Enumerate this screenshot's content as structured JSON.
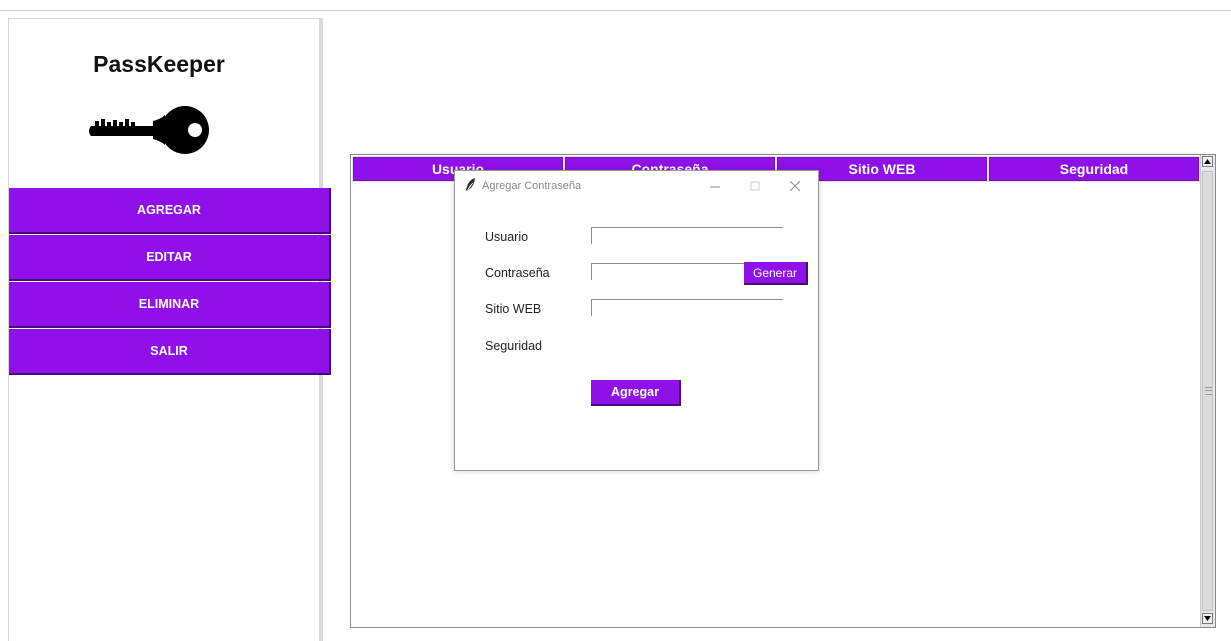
{
  "app": {
    "title": "PassKeeper",
    "colors": {
      "accent": "#9010ea",
      "accent_dark": "#4a0a7a",
      "background": "#ffffff"
    },
    "logo_icon": "key-icon"
  },
  "sidebar": {
    "buttons": [
      {
        "label": "AGREGAR"
      },
      {
        "label": "EDITAR"
      },
      {
        "label": "ELIMINAR"
      },
      {
        "label": "SALIR"
      }
    ]
  },
  "table": {
    "columns": [
      "Usuario",
      "Contraseña",
      "Sitio WEB",
      "Seguridad"
    ],
    "rows": []
  },
  "dialog": {
    "title": "Agregar Contraseña",
    "icon": "feather-icon",
    "window_controls": [
      "minimize-icon",
      "maximize-icon",
      "close-icon"
    ],
    "fields": {
      "usuario": {
        "label": "Usuario",
        "value": ""
      },
      "contrasena": {
        "label": "Contraseña",
        "value": ""
      },
      "sitio_web": {
        "label": "Sitio WEB",
        "value": ""
      },
      "seguridad": {
        "label": "Seguridad",
        "value": ""
      }
    },
    "generate_label": "Generar",
    "submit_label": "Agregar"
  }
}
